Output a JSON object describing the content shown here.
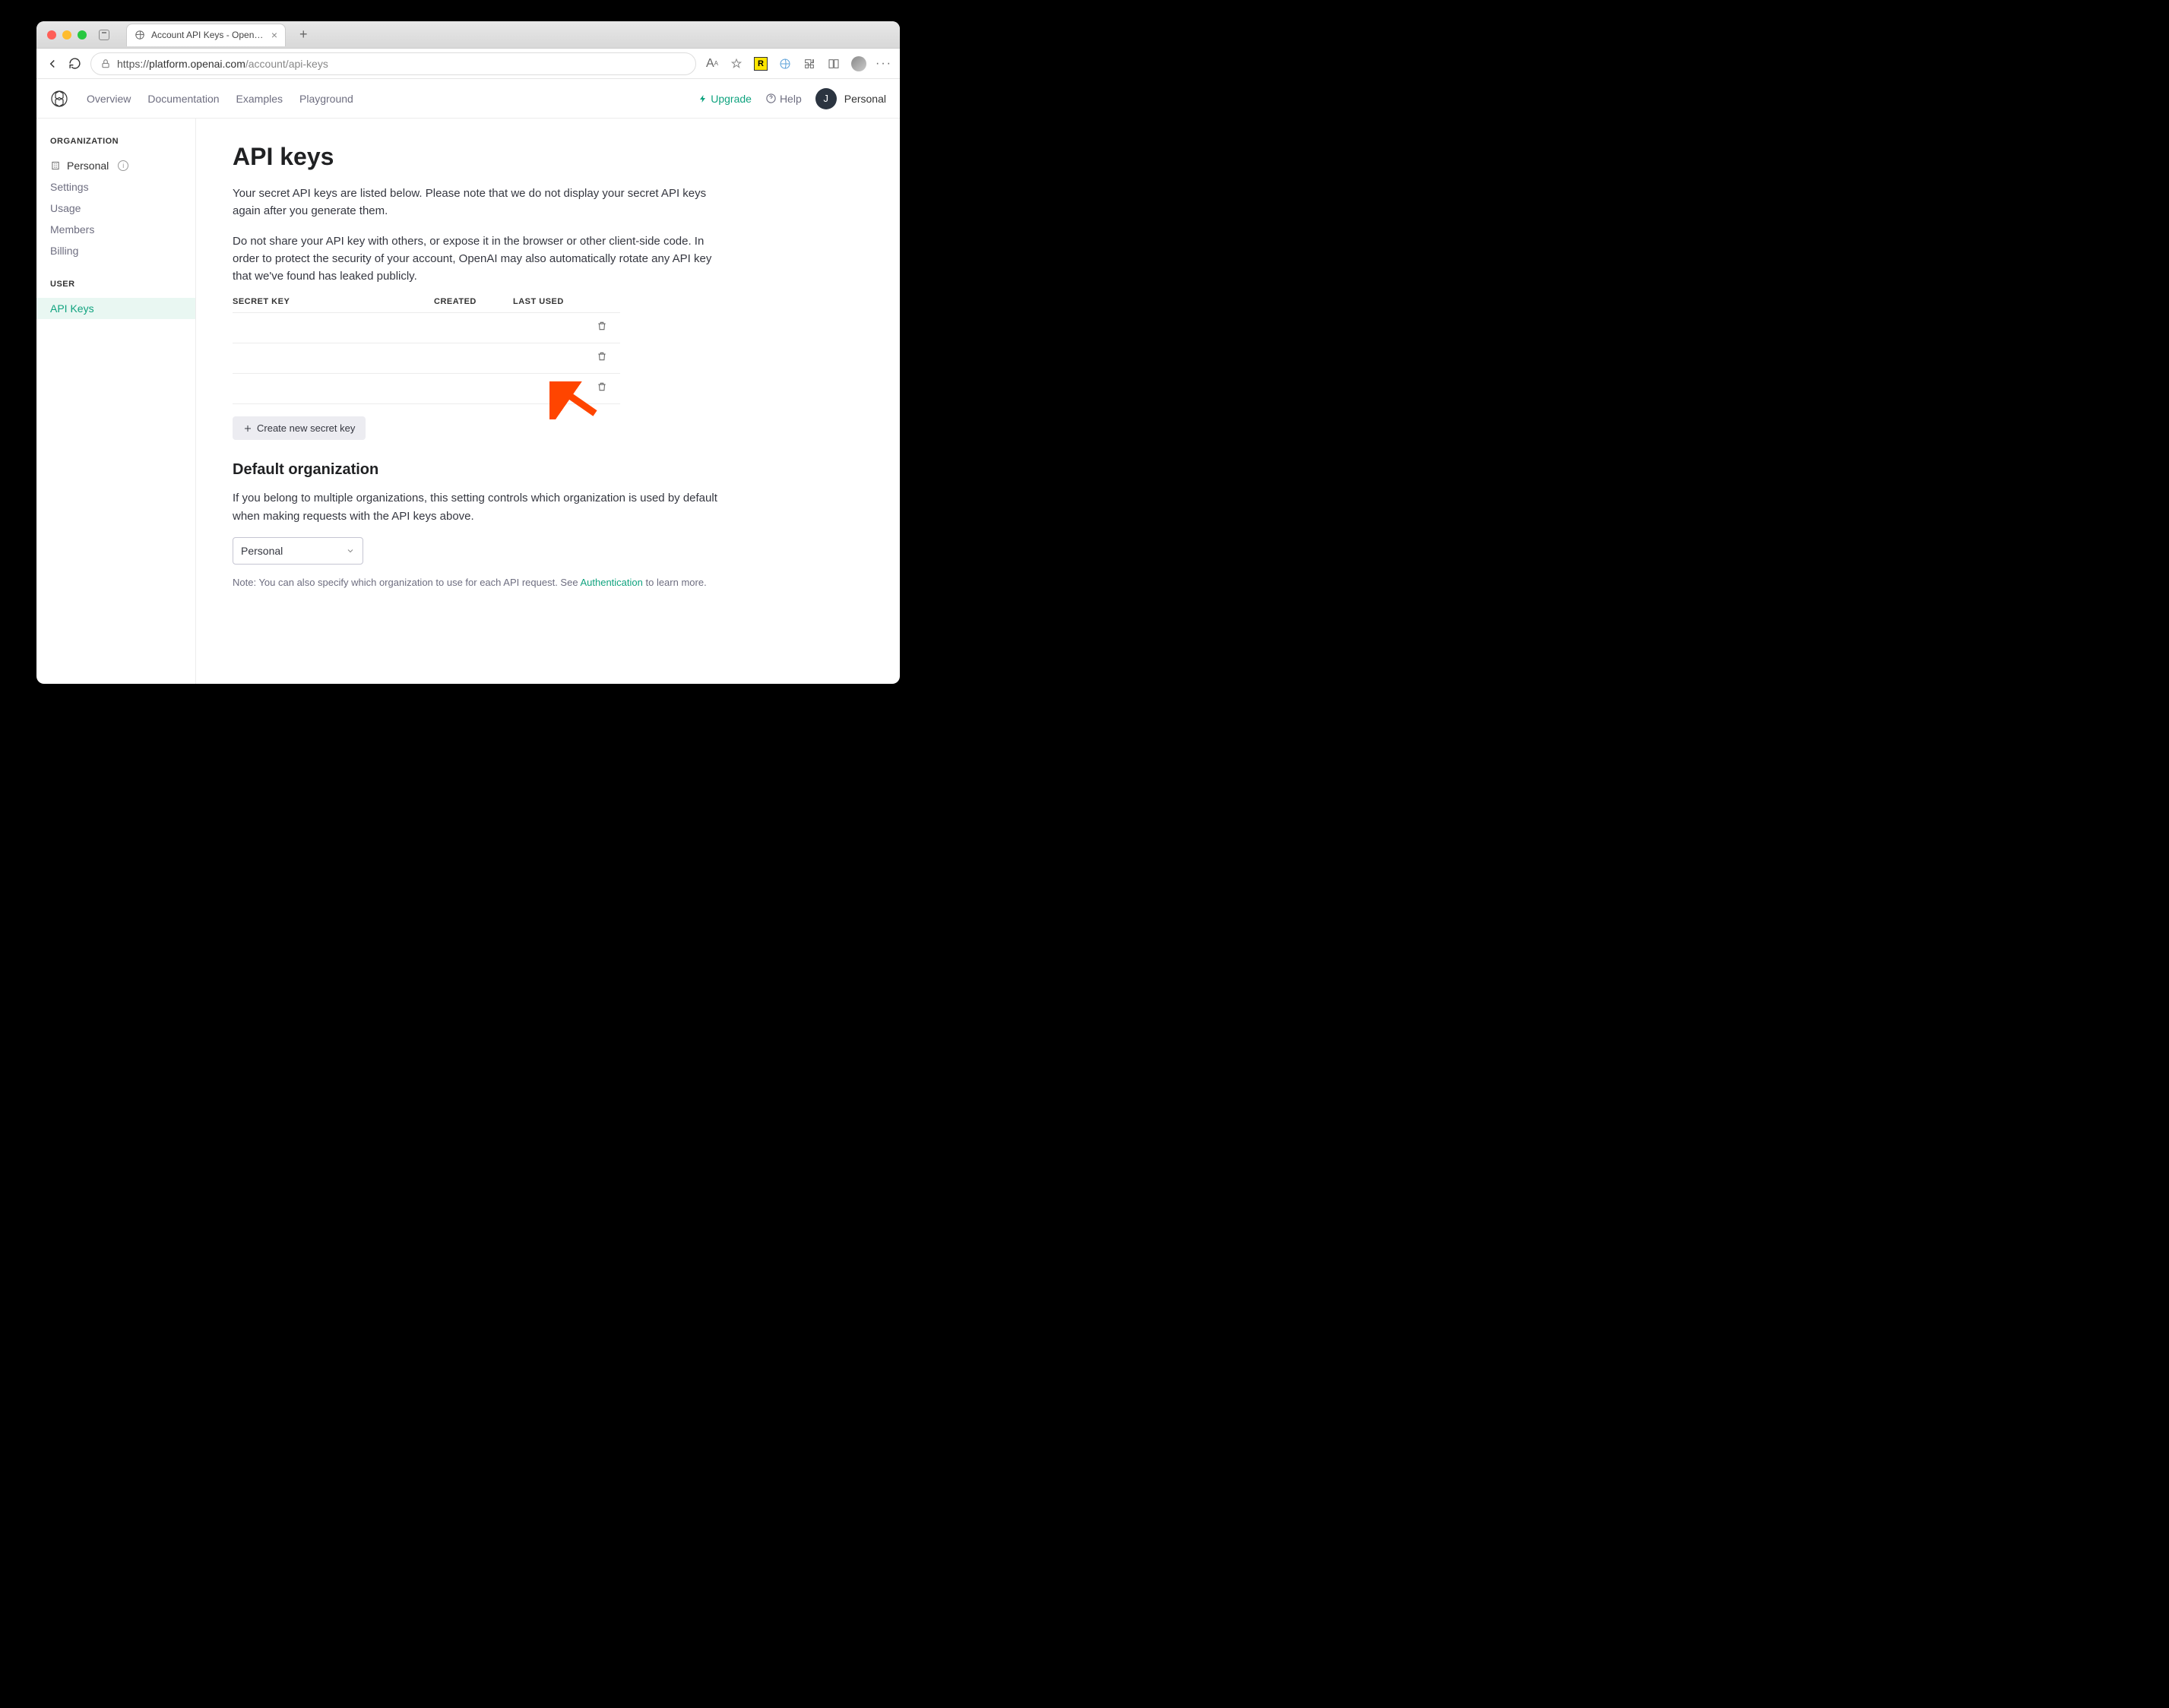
{
  "browser": {
    "tab_title": "Account API Keys - OpenAI AP",
    "url_host": "platform.openai.com",
    "url_path": "/account/api-keys",
    "r_badge": "R"
  },
  "header": {
    "nav": [
      "Overview",
      "Documentation",
      "Examples",
      "Playground"
    ],
    "upgrade": "Upgrade",
    "help": "Help",
    "user_initial": "J",
    "user_label": "Personal"
  },
  "sidebar": {
    "org_title": "ORGANIZATION",
    "personal": "Personal",
    "items": [
      "Settings",
      "Usage",
      "Members",
      "Billing"
    ],
    "user_title": "USER",
    "api_keys": "API Keys"
  },
  "page": {
    "title": "API keys",
    "p1": "Your secret API keys are listed below. Please note that we do not display your secret API keys again after you generate them.",
    "p2": "Do not share your API key with others, or expose it in the browser or other client-side code. In order to protect the security of your account, OpenAI may also automatically rotate any API key that we've found has leaked publicly.",
    "col_key": "SECRET KEY",
    "col_created": "CREATED",
    "col_used": "LAST USED",
    "create_btn": "Create new secret key",
    "default_org_title": "Default organization",
    "default_org_text": "If you belong to multiple organizations, this setting controls which organization is used by default when making requests with the API keys above.",
    "select_value": "Personal",
    "note_prefix": "Note: You can also specify which organization to use for each API request. See ",
    "note_link": "Authentication",
    "note_suffix": " to learn more."
  }
}
